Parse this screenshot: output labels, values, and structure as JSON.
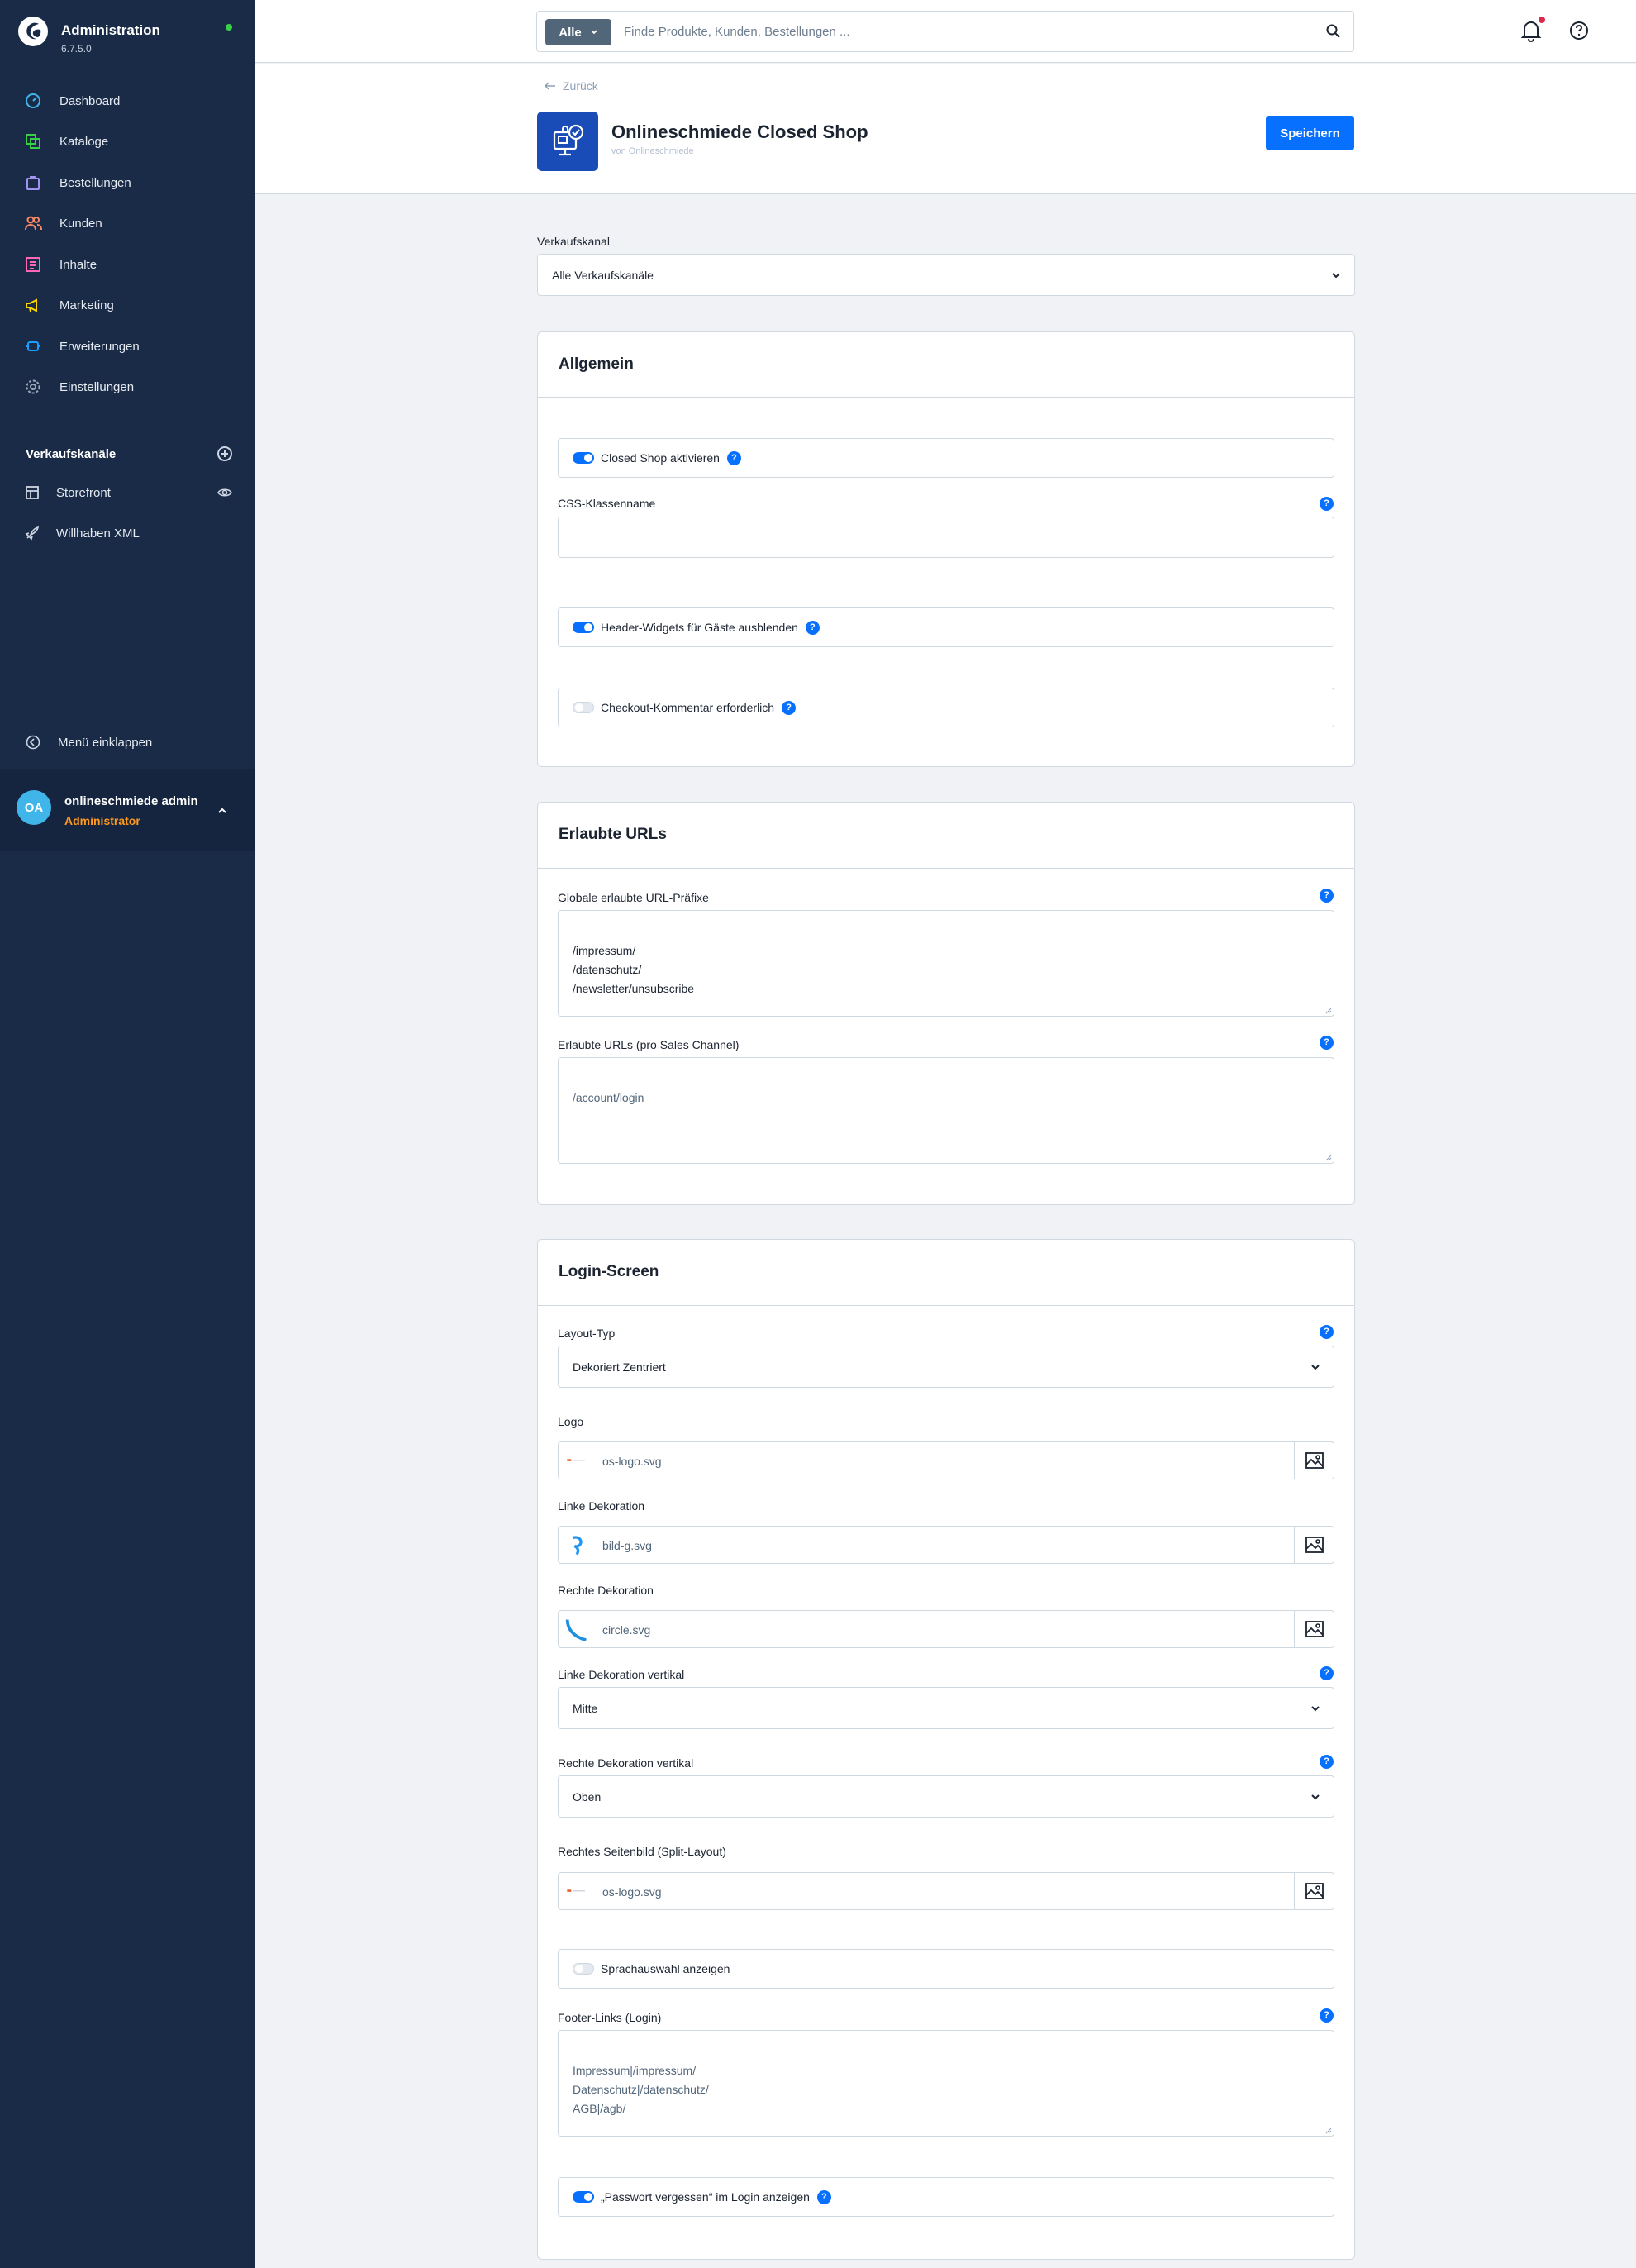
{
  "app": {
    "title": "Administration",
    "version": "6.7.5.0"
  },
  "sidebar": {
    "nav": [
      {
        "label": "Dashboard",
        "icon": "dashboard-icon",
        "color": "#3fb5ea"
      },
      {
        "label": "Kataloge",
        "icon": "catalog-icon",
        "color": "#37d046"
      },
      {
        "label": "Bestellungen",
        "icon": "orders-icon",
        "color": "#a092f0"
      },
      {
        "label": "Kunden",
        "icon": "customers-icon",
        "color": "#f88962"
      },
      {
        "label": "Inhalte",
        "icon": "content-icon",
        "color": "#ff68b4"
      },
      {
        "label": "Marketing",
        "icon": "marketing-icon",
        "color": "#ffd700"
      },
      {
        "label": "Erweiterungen",
        "icon": "extensions-icon",
        "color": "#189eff"
      },
      {
        "label": "Einstellungen",
        "icon": "settings-icon",
        "color": "#9aa8b5"
      }
    ],
    "sales_channels_heading": "Verkaufskanäle",
    "sales_channels": [
      {
        "label": "Storefront",
        "icon": "storefront-icon"
      },
      {
        "label": "Willhaben XML",
        "icon": "rocket-icon"
      }
    ],
    "collapse_label": "Menü einklappen",
    "user": {
      "initials": "OA",
      "name": "onlineschmiede admin",
      "role": "Administrator"
    }
  },
  "topbar": {
    "search_type": "Alle",
    "search_placeholder": "Finde Produkte, Kunden, Bestellungen ..."
  },
  "page": {
    "back_label": "Zurück",
    "title": "Onlineschmiede Closed Shop",
    "byline": "von Onlineschmiede",
    "save_label": "Speichern"
  },
  "sales_channel": {
    "label": "Verkaufskanal",
    "value": "Alle Verkaufskanäle"
  },
  "general": {
    "title": "Allgemein",
    "closed_shop": {
      "label": "Closed Shop aktivieren",
      "on": true
    },
    "css_class": {
      "label": "CSS-Klassenname",
      "value": ""
    },
    "hide_header_widgets": {
      "label": "Header-Widgets für Gäste ausblenden",
      "on": true
    },
    "checkout_comment": {
      "label": "Checkout-Kommentar erforderlich",
      "on": false
    }
  },
  "allowed_urls": {
    "title": "Erlaubte URLs",
    "global_prefixes": {
      "label": "Globale erlaubte URL-Präfixe",
      "value": "/impressum/\n/datenschutz/\n/newsletter/unsubscribe"
    },
    "per_channel": {
      "label": "Erlaubte URLs (pro Sales Channel)",
      "placeholder": "/account/login"
    }
  },
  "login_screen": {
    "title": "Login-Screen",
    "layout_type": {
      "label": "Layout-Typ",
      "value": "Dekoriert Zentriert"
    },
    "logo": {
      "label": "Logo",
      "file": "os-logo.svg"
    },
    "left_decoration": {
      "label": "Linke Dekoration",
      "file": "bild-g.svg"
    },
    "right_decoration": {
      "label": "Rechte Dekoration",
      "file": "circle.svg"
    },
    "left_vertical": {
      "label": "Linke Dekoration vertikal",
      "value": "Mitte"
    },
    "right_vertical": {
      "label": "Rechte Dekoration vertikal",
      "value": "Oben"
    },
    "right_side_image": {
      "label": "Rechtes Seitenbild (Split-Layout)",
      "file": "os-logo.svg"
    },
    "language_switch": {
      "label": "Sprachauswahl anzeigen",
      "on": false
    },
    "footer_links": {
      "label": "Footer-Links (Login)",
      "placeholder": "Impressum|/impressum/\nDatenschutz|/datenschutz/\nAGB|/agb/"
    },
    "forgot_password": {
      "label": "„Passwort vergessen“ im Login anzeigen",
      "on": true
    }
  }
}
